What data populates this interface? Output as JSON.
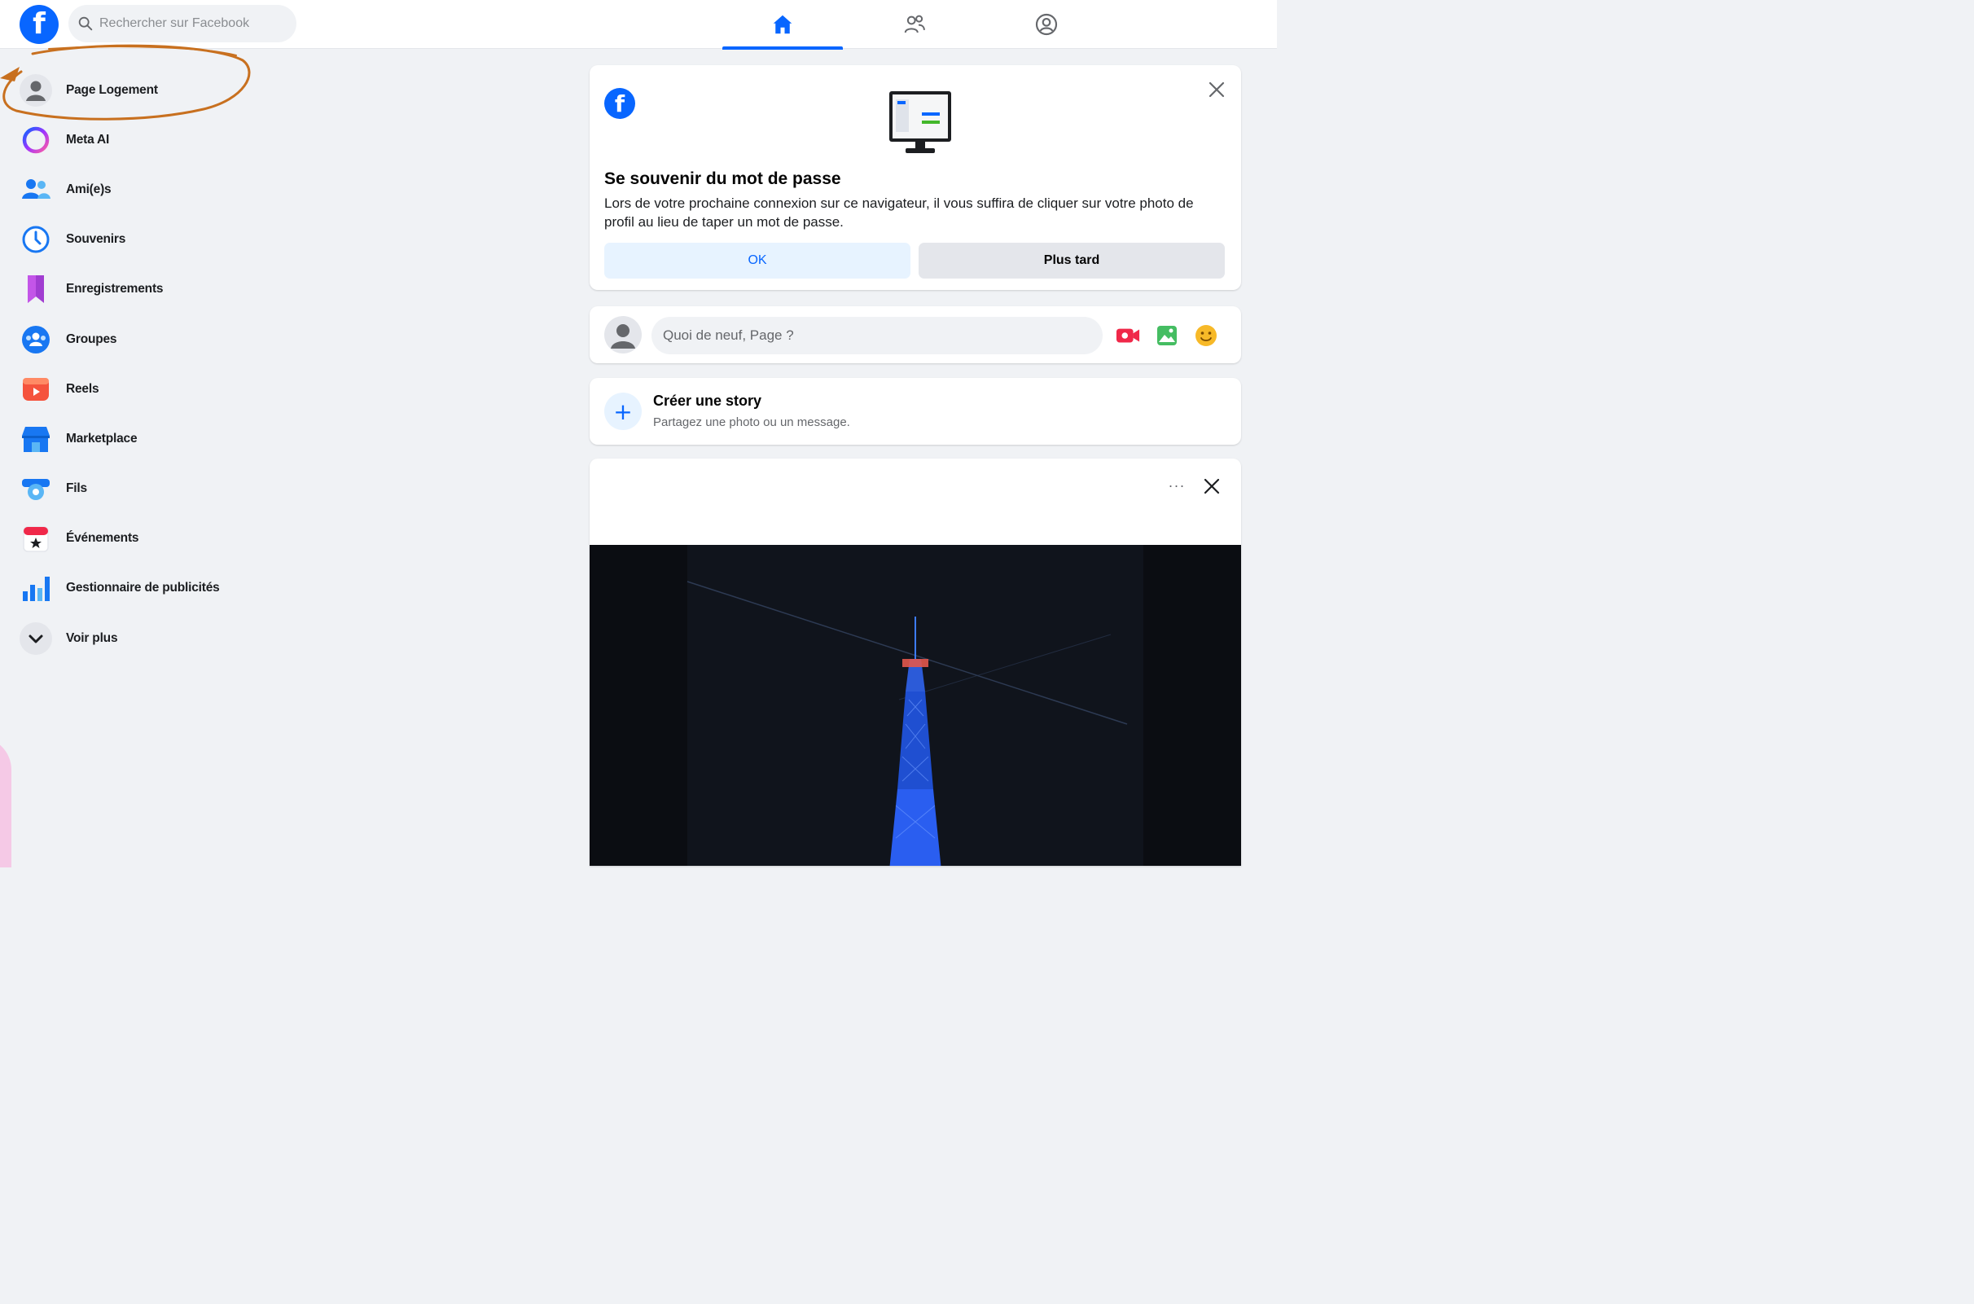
{
  "colors": {
    "brand_blue": "#0866ff",
    "page_bg": "#f0f2f5",
    "annotation_orange": "#c8701f"
  },
  "header": {
    "logo_icon": "facebook-logo-icon",
    "search": {
      "placeholder": "Rechercher sur Facebook",
      "icon": "search-icon"
    },
    "tabs": [
      {
        "name": "home",
        "icon": "home-icon",
        "active": true
      },
      {
        "name": "friends",
        "icon": "friends-icon",
        "active": false
      },
      {
        "name": "profile",
        "icon": "profile-icon",
        "active": false
      }
    ]
  },
  "sidebar": {
    "items": [
      {
        "label": "Page Logement",
        "icon": "profile-avatar-icon"
      },
      {
        "label": "Meta AI",
        "icon": "meta-ai-icon"
      },
      {
        "label": "Ami(e)s",
        "icon": "friends-icon"
      },
      {
        "label": "Souvenirs",
        "icon": "memories-clock-icon"
      },
      {
        "label": "Enregistrements",
        "icon": "bookmark-icon"
      },
      {
        "label": "Groupes",
        "icon": "groups-icon"
      },
      {
        "label": "Reels",
        "icon": "reels-icon"
      },
      {
        "label": "Marketplace",
        "icon": "marketplace-shop-icon"
      },
      {
        "label": "Fils",
        "icon": "feeds-icon"
      },
      {
        "label": "Événements",
        "icon": "calendar-star-icon"
      },
      {
        "label": "Gestionnaire de publicités",
        "icon": "ads-chart-icon"
      },
      {
        "label": "Voir plus",
        "icon": "chevron-down-icon"
      }
    ]
  },
  "password_card": {
    "title": "Se souvenir du mot de passe",
    "body": "Lors de votre prochaine connexion sur ce navigateur, il vous suffira de cliquer sur votre photo de profil au lieu de taper un mot de passe.",
    "ok_label": "OK",
    "later_label": "Plus tard"
  },
  "composer": {
    "placeholder": "Quoi de neuf, Page ?",
    "actions": [
      "live-video-icon",
      "photo-icon",
      "feeling-smiley-icon"
    ]
  },
  "story": {
    "title": "Créer une story",
    "subtitle": "Partagez une photo ou un message.",
    "plus": "+"
  },
  "feed_post": {
    "more_label": "···",
    "image": "eiffel-tower-night-photo"
  }
}
